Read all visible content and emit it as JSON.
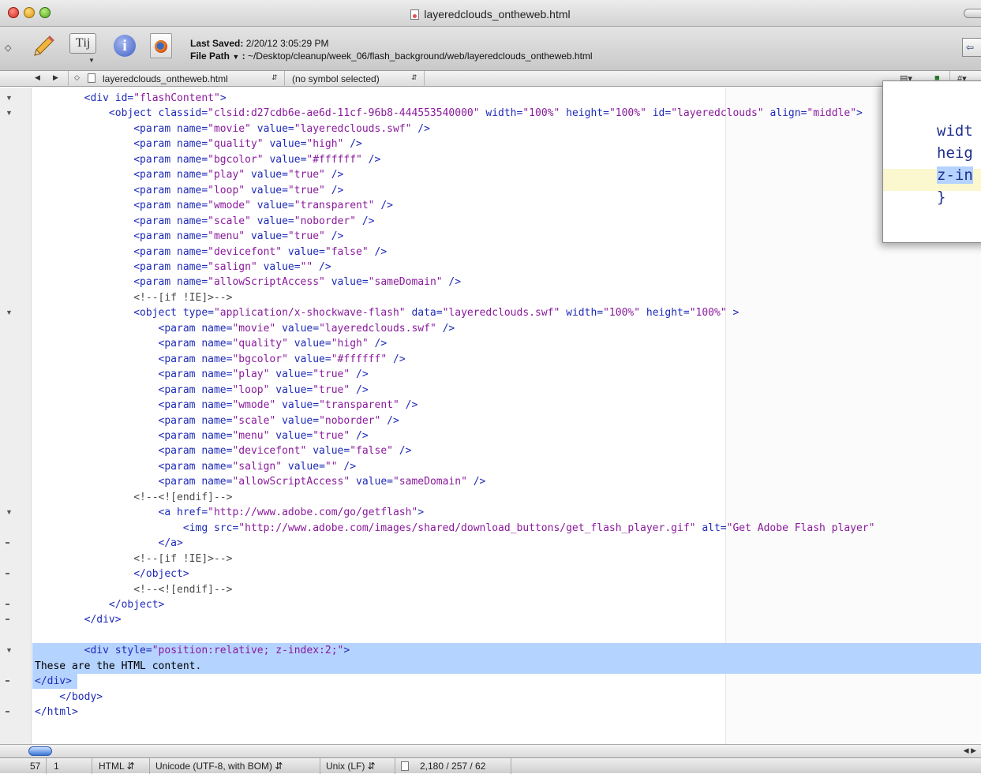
{
  "window": {
    "title": "layeredclouds_ontheweb.html"
  },
  "toolbar": {
    "last_saved_label": "Last Saved:",
    "last_saved_value": "2/20/12 3:05:29 PM",
    "file_path_label": "File Path",
    "file_path_value": "~/Desktop/cleanup/week_06/flash_background/web/layeredclouds_ontheweb.html",
    "text_tool_glyph": "Tĳ"
  },
  "navbar": {
    "file_name": "layeredclouds_ontheweb.html",
    "symbol": "(no symbol selected)",
    "counterpart": "#"
  },
  "code_lines": [
    [
      [
        "t",
        "        <div "
      ],
      [
        "a",
        "id"
      ],
      [
        "t",
        "="
      ],
      [
        "v",
        "\"flashContent\""
      ],
      [
        "t",
        ">"
      ]
    ],
    [
      [
        "t",
        "            <object "
      ],
      [
        "a",
        "classid"
      ],
      [
        "t",
        "="
      ],
      [
        "v",
        "\"clsid:d27cdb6e-ae6d-11cf-96b8-444553540000\""
      ],
      [
        "t",
        " "
      ],
      [
        "a",
        "width"
      ],
      [
        "t",
        "="
      ],
      [
        "v",
        "\"100%\""
      ],
      [
        "t",
        " "
      ],
      [
        "a",
        "height"
      ],
      [
        "t",
        "="
      ],
      [
        "v",
        "\"100%\""
      ],
      [
        "t",
        " "
      ],
      [
        "a",
        "id"
      ],
      [
        "t",
        "="
      ],
      [
        "v",
        "\"layeredclouds\""
      ],
      [
        "t",
        " "
      ],
      [
        "a",
        "align"
      ],
      [
        "t",
        "="
      ],
      [
        "v",
        "\"middle\""
      ],
      [
        "t",
        ">"
      ]
    ],
    [
      [
        "t",
        "                <param "
      ],
      [
        "a",
        "name"
      ],
      [
        "t",
        "="
      ],
      [
        "v",
        "\"movie\""
      ],
      [
        "t",
        " "
      ],
      [
        "a",
        "value"
      ],
      [
        "t",
        "="
      ],
      [
        "v",
        "\"layeredclouds.swf\""
      ],
      [
        "t",
        " />"
      ]
    ],
    [
      [
        "t",
        "                <param "
      ],
      [
        "a",
        "name"
      ],
      [
        "t",
        "="
      ],
      [
        "v",
        "\"quality\""
      ],
      [
        "t",
        " "
      ],
      [
        "a",
        "value"
      ],
      [
        "t",
        "="
      ],
      [
        "v",
        "\"high\""
      ],
      [
        "t",
        " />"
      ]
    ],
    [
      [
        "t",
        "                <param "
      ],
      [
        "a",
        "name"
      ],
      [
        "t",
        "="
      ],
      [
        "v",
        "\"bgcolor\""
      ],
      [
        "t",
        " "
      ],
      [
        "a",
        "value"
      ],
      [
        "t",
        "="
      ],
      [
        "v",
        "\"#ffffff\""
      ],
      [
        "t",
        " />"
      ]
    ],
    [
      [
        "t",
        "                <param "
      ],
      [
        "a",
        "name"
      ],
      [
        "t",
        "="
      ],
      [
        "v",
        "\"play\""
      ],
      [
        "t",
        " "
      ],
      [
        "a",
        "value"
      ],
      [
        "t",
        "="
      ],
      [
        "v",
        "\"true\""
      ],
      [
        "t",
        " />"
      ]
    ],
    [
      [
        "t",
        "                <param "
      ],
      [
        "a",
        "name"
      ],
      [
        "t",
        "="
      ],
      [
        "v",
        "\"loop\""
      ],
      [
        "t",
        " "
      ],
      [
        "a",
        "value"
      ],
      [
        "t",
        "="
      ],
      [
        "v",
        "\"true\""
      ],
      [
        "t",
        " />"
      ]
    ],
    [
      [
        "t",
        "                <param "
      ],
      [
        "a",
        "name"
      ],
      [
        "t",
        "="
      ],
      [
        "v",
        "\"wmode\""
      ],
      [
        "t",
        " "
      ],
      [
        "a",
        "value"
      ],
      [
        "t",
        "="
      ],
      [
        "v",
        "\"transparent\""
      ],
      [
        "t",
        " />"
      ]
    ],
    [
      [
        "t",
        "                <param "
      ],
      [
        "a",
        "name"
      ],
      [
        "t",
        "="
      ],
      [
        "v",
        "\"scale\""
      ],
      [
        "t",
        " "
      ],
      [
        "a",
        "value"
      ],
      [
        "t",
        "="
      ],
      [
        "v",
        "\"noborder\""
      ],
      [
        "t",
        " />"
      ]
    ],
    [
      [
        "t",
        "                <param "
      ],
      [
        "a",
        "name"
      ],
      [
        "t",
        "="
      ],
      [
        "v",
        "\"menu\""
      ],
      [
        "t",
        " "
      ],
      [
        "a",
        "value"
      ],
      [
        "t",
        "="
      ],
      [
        "v",
        "\"true\""
      ],
      [
        "t",
        " />"
      ]
    ],
    [
      [
        "t",
        "                <param "
      ],
      [
        "a",
        "name"
      ],
      [
        "t",
        "="
      ],
      [
        "v",
        "\"devicefont\""
      ],
      [
        "t",
        " "
      ],
      [
        "a",
        "value"
      ],
      [
        "t",
        "="
      ],
      [
        "v",
        "\"false\""
      ],
      [
        "t",
        " />"
      ]
    ],
    [
      [
        "t",
        "                <param "
      ],
      [
        "a",
        "name"
      ],
      [
        "t",
        "="
      ],
      [
        "v",
        "\"salign\""
      ],
      [
        "t",
        " "
      ],
      [
        "a",
        "value"
      ],
      [
        "t",
        "="
      ],
      [
        "v",
        "\"\""
      ],
      [
        "t",
        " />"
      ]
    ],
    [
      [
        "t",
        "                <param "
      ],
      [
        "a",
        "name"
      ],
      [
        "t",
        "="
      ],
      [
        "v",
        "\"allowScriptAccess\""
      ],
      [
        "t",
        " "
      ],
      [
        "a",
        "value"
      ],
      [
        "t",
        "="
      ],
      [
        "v",
        "\"sameDomain\""
      ],
      [
        "t",
        " />"
      ]
    ],
    [
      [
        "c",
        "                <!--[if !IE]>-->"
      ]
    ],
    [
      [
        "t",
        "                <object "
      ],
      [
        "a",
        "type"
      ],
      [
        "t",
        "="
      ],
      [
        "v",
        "\"application/x-shockwave-flash\""
      ],
      [
        "t",
        " "
      ],
      [
        "a",
        "data"
      ],
      [
        "t",
        "="
      ],
      [
        "v",
        "\"layeredclouds.swf\""
      ],
      [
        "t",
        " "
      ],
      [
        "a",
        "width"
      ],
      [
        "t",
        "="
      ],
      [
        "v",
        "\"100%\""
      ],
      [
        "t",
        " "
      ],
      [
        "a",
        "height"
      ],
      [
        "t",
        "="
      ],
      [
        "v",
        "\"100%\""
      ],
      [
        "t",
        " >"
      ]
    ],
    [
      [
        "t",
        "                    <param "
      ],
      [
        "a",
        "name"
      ],
      [
        "t",
        "="
      ],
      [
        "v",
        "\"movie\""
      ],
      [
        "t",
        " "
      ],
      [
        "a",
        "value"
      ],
      [
        "t",
        "="
      ],
      [
        "v",
        "\"layeredclouds.swf\""
      ],
      [
        "t",
        " />"
      ]
    ],
    [
      [
        "t",
        "                    <param "
      ],
      [
        "a",
        "name"
      ],
      [
        "t",
        "="
      ],
      [
        "v",
        "\"quality\""
      ],
      [
        "t",
        " "
      ],
      [
        "a",
        "value"
      ],
      [
        "t",
        "="
      ],
      [
        "v",
        "\"high\""
      ],
      [
        "t",
        " />"
      ]
    ],
    [
      [
        "t",
        "                    <param "
      ],
      [
        "a",
        "name"
      ],
      [
        "t",
        "="
      ],
      [
        "v",
        "\"bgcolor\""
      ],
      [
        "t",
        " "
      ],
      [
        "a",
        "value"
      ],
      [
        "t",
        "="
      ],
      [
        "v",
        "\"#ffffff\""
      ],
      [
        "t",
        " />"
      ]
    ],
    [
      [
        "t",
        "                    <param "
      ],
      [
        "a",
        "name"
      ],
      [
        "t",
        "="
      ],
      [
        "v",
        "\"play\""
      ],
      [
        "t",
        " "
      ],
      [
        "a",
        "value"
      ],
      [
        "t",
        "="
      ],
      [
        "v",
        "\"true\""
      ],
      [
        "t",
        " />"
      ]
    ],
    [
      [
        "t",
        "                    <param "
      ],
      [
        "a",
        "name"
      ],
      [
        "t",
        "="
      ],
      [
        "v",
        "\"loop\""
      ],
      [
        "t",
        " "
      ],
      [
        "a",
        "value"
      ],
      [
        "t",
        "="
      ],
      [
        "v",
        "\"true\""
      ],
      [
        "t",
        " />"
      ]
    ],
    [
      [
        "t",
        "                    <param "
      ],
      [
        "a",
        "name"
      ],
      [
        "t",
        "="
      ],
      [
        "v",
        "\"wmode\""
      ],
      [
        "t",
        " "
      ],
      [
        "a",
        "value"
      ],
      [
        "t",
        "="
      ],
      [
        "v",
        "\"transparent\""
      ],
      [
        "t",
        " />"
      ]
    ],
    [
      [
        "t",
        "                    <param "
      ],
      [
        "a",
        "name"
      ],
      [
        "t",
        "="
      ],
      [
        "v",
        "\"scale\""
      ],
      [
        "t",
        " "
      ],
      [
        "a",
        "value"
      ],
      [
        "t",
        "="
      ],
      [
        "v",
        "\"noborder\""
      ],
      [
        "t",
        " />"
      ]
    ],
    [
      [
        "t",
        "                    <param "
      ],
      [
        "a",
        "name"
      ],
      [
        "t",
        "="
      ],
      [
        "v",
        "\"menu\""
      ],
      [
        "t",
        " "
      ],
      [
        "a",
        "value"
      ],
      [
        "t",
        "="
      ],
      [
        "v",
        "\"true\""
      ],
      [
        "t",
        " />"
      ]
    ],
    [
      [
        "t",
        "                    <param "
      ],
      [
        "a",
        "name"
      ],
      [
        "t",
        "="
      ],
      [
        "v",
        "\"devicefont\""
      ],
      [
        "t",
        " "
      ],
      [
        "a",
        "value"
      ],
      [
        "t",
        "="
      ],
      [
        "v",
        "\"false\""
      ],
      [
        "t",
        " />"
      ]
    ],
    [
      [
        "t",
        "                    <param "
      ],
      [
        "a",
        "name"
      ],
      [
        "t",
        "="
      ],
      [
        "v",
        "\"salign\""
      ],
      [
        "t",
        " "
      ],
      [
        "a",
        "value"
      ],
      [
        "t",
        "="
      ],
      [
        "v",
        "\"\""
      ],
      [
        "t",
        " />"
      ]
    ],
    [
      [
        "t",
        "                    <param "
      ],
      [
        "a",
        "name"
      ],
      [
        "t",
        "="
      ],
      [
        "v",
        "\"allowScriptAccess\""
      ],
      [
        "t",
        " "
      ],
      [
        "a",
        "value"
      ],
      [
        "t",
        "="
      ],
      [
        "v",
        "\"sameDomain\""
      ],
      [
        "t",
        " />"
      ]
    ],
    [
      [
        "c",
        "                <!--<![endif]-->"
      ]
    ],
    [
      [
        "t",
        "                    <a "
      ],
      [
        "a",
        "href"
      ],
      [
        "t",
        "="
      ],
      [
        "v",
        "\"http://www.adobe.com/go/getflash\""
      ],
      [
        "t",
        ">"
      ]
    ],
    [
      [
        "t",
        "                        <img "
      ],
      [
        "a",
        "src"
      ],
      [
        "t",
        "="
      ],
      [
        "v",
        "\"http://www.adobe.com/images/shared/download_buttons/get_flash_player.gif\""
      ],
      [
        "t",
        " "
      ],
      [
        "a",
        "alt"
      ],
      [
        "t",
        "="
      ],
      [
        "v",
        "\"Get Adobe Flash player\""
      ]
    ],
    [
      [
        "t",
        "                    </a>"
      ]
    ],
    [
      [
        "c",
        "                <!--[if !IE]>-->"
      ]
    ],
    [
      [
        "t",
        "                </object>"
      ]
    ],
    [
      [
        "c",
        "                <!--<![endif]-->"
      ]
    ],
    [
      [
        "t",
        "            </object>"
      ]
    ],
    [
      [
        "t",
        "        </div>"
      ]
    ],
    [
      [
        "tx",
        ""
      ]
    ],
    [
      [
        "t",
        "        <div "
      ],
      [
        "a",
        "style"
      ],
      [
        "t",
        "="
      ],
      [
        "v",
        "\"position:relative; z-index:2;\""
      ],
      [
        "t",
        ">"
      ]
    ],
    [
      [
        "tx",
        "These are the HTML content."
      ]
    ],
    [
      [
        "t",
        "</div>"
      ]
    ],
    [
      [
        "t",
        "    </body>"
      ]
    ],
    [
      [
        "t",
        "</html>"
      ]
    ]
  ],
  "gutter_folds": [
    {
      "line": 0,
      "kind": "open"
    },
    {
      "line": 1,
      "kind": "open"
    },
    {
      "line": 14,
      "kind": "open"
    },
    {
      "line": 27,
      "kind": "open"
    },
    {
      "line": 29,
      "kind": "end"
    },
    {
      "line": 31,
      "kind": "end"
    },
    {
      "line": 33,
      "kind": "end"
    },
    {
      "line": 34,
      "kind": "end"
    },
    {
      "line": 36,
      "kind": "open"
    },
    {
      "line": 38,
      "kind": "end"
    },
    {
      "line": 40,
      "kind": "end"
    }
  ],
  "overlay": {
    "lines": [
      "widt",
      "heig",
      "z-in",
      "}"
    ]
  },
  "statusbar": {
    "line": "57",
    "column": "1",
    "language": "HTML",
    "encoding": "Unicode (UTF-8, with BOM)",
    "line_endings": "Unix (LF)",
    "counts": "2,180 / 257 / 62"
  }
}
